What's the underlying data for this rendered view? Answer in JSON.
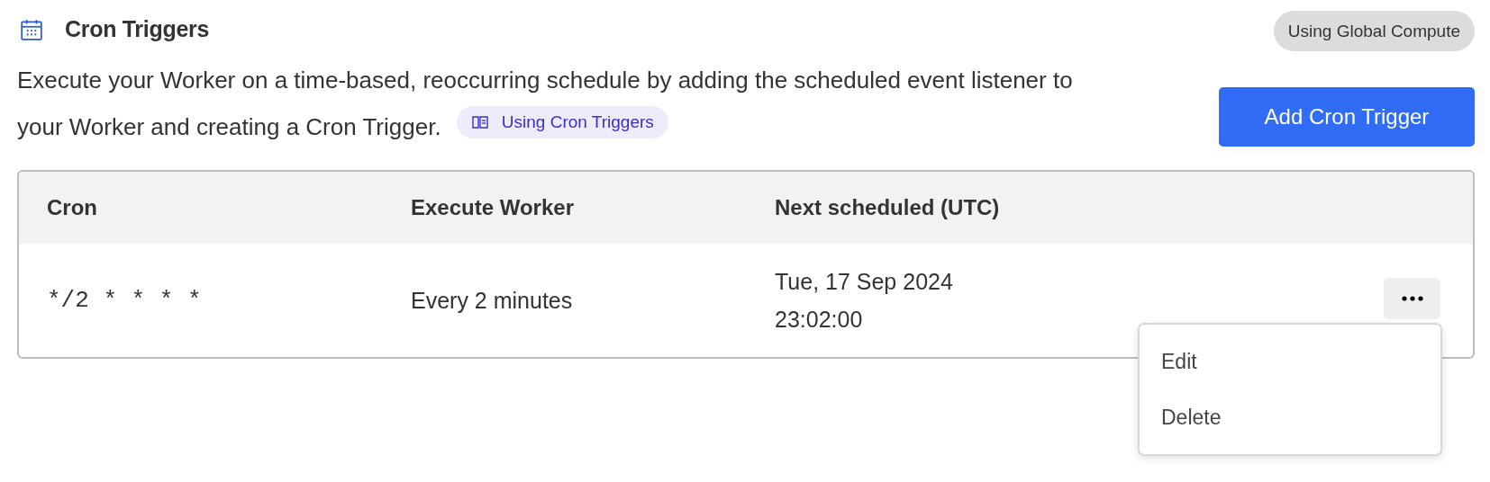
{
  "header": {
    "title": "Cron Triggers",
    "badge": "Using Global Compute"
  },
  "description": {
    "text": "Execute your Worker on a time-based, reoccurring schedule by adding the scheduled event listener to your Worker and creating a Cron Trigger.",
    "link": "Using Cron Triggers"
  },
  "add_button": "Add Cron Trigger",
  "table": {
    "columns": [
      "Cron",
      "Execute Worker",
      "Next scheduled (UTC)"
    ],
    "rows": [
      {
        "cron": "*/2 * * * *",
        "execute": "Every 2 minutes",
        "next": [
          "Tue, 17 Sep 2024",
          "23:02:00"
        ],
        "menu_open": true,
        "menu": [
          "Edit",
          "Delete"
        ]
      }
    ]
  }
}
